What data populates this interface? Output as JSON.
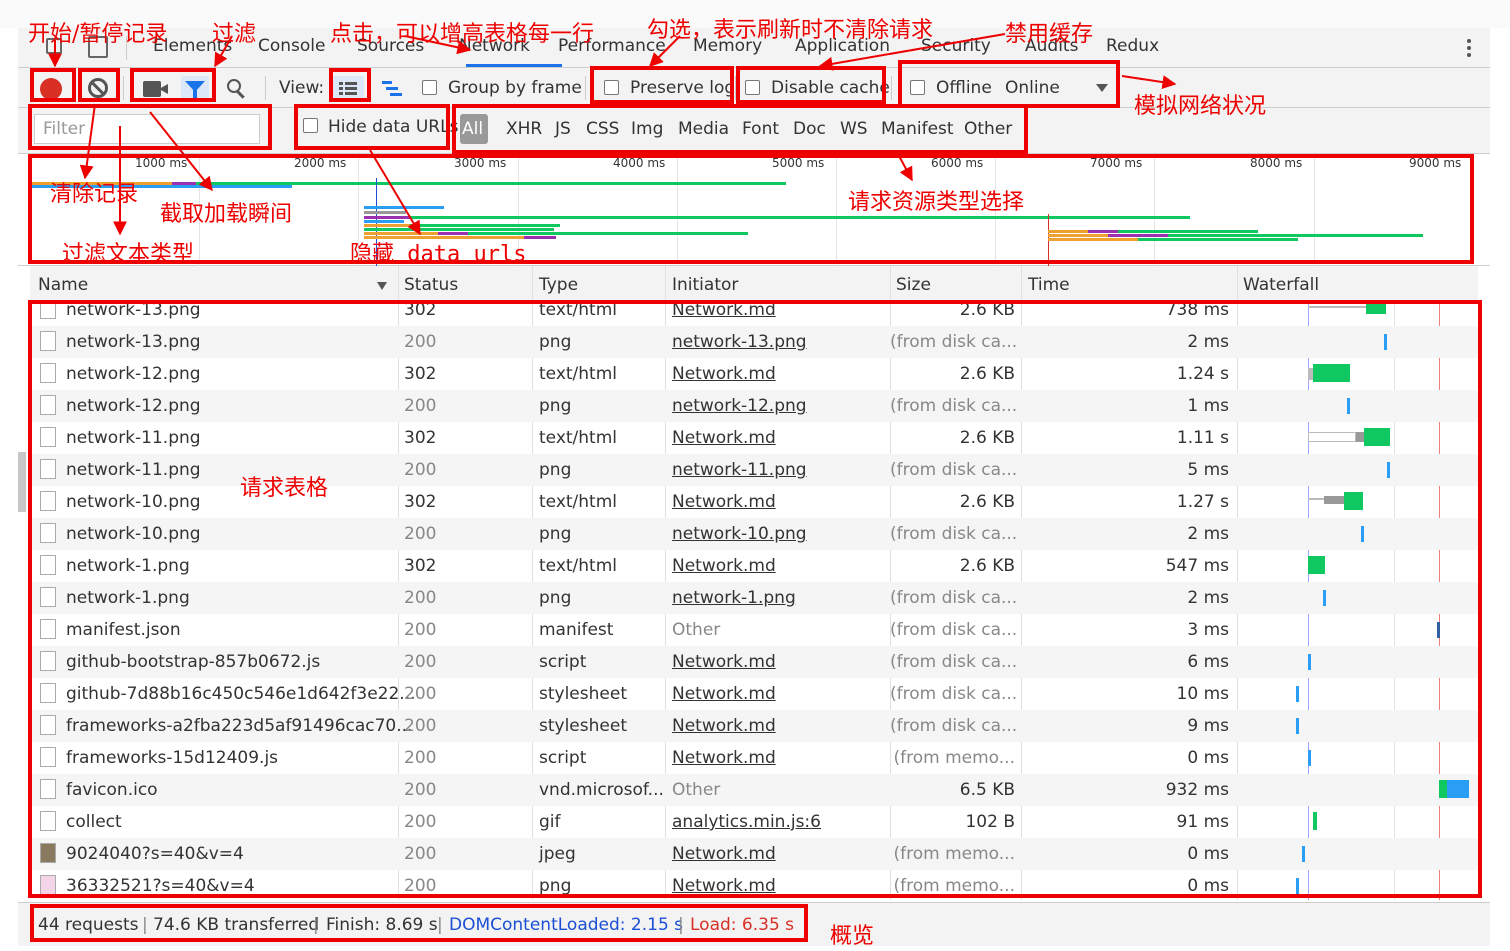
{
  "tabs": [
    "Elements",
    "Console",
    "Sources",
    "Network",
    "Performance",
    "Memory",
    "Application",
    "Security",
    "Audits",
    "Redux"
  ],
  "toolbar": {
    "view_label": "View:",
    "group_by_frame": "Group by frame",
    "preserve_log": "Preserve log",
    "disable_cache": "Disable cache",
    "offline": "Offline",
    "online": "Online",
    "filter_placeholder": "Filter",
    "hide_data_urls": "Hide data URLs",
    "types": [
      "All",
      "XHR",
      "JS",
      "CSS",
      "Img",
      "Media",
      "Font",
      "Doc",
      "WS",
      "Manifest",
      "Other"
    ]
  },
  "overview": {
    "ticks": [
      "1000 ms",
      "2000 ms",
      "3000 ms",
      "4000 ms",
      "5000 ms",
      "6000 ms",
      "7000 ms",
      "8000 ms",
      "9000 ms"
    ]
  },
  "columns": [
    "Name",
    "Status",
    "Type",
    "Initiator",
    "Size",
    "Time",
    "Waterfall"
  ],
  "rows": [
    {
      "name": "network-13.png",
      "status": "302",
      "type": "text/html",
      "initiator": "Network.md",
      "size": "2.6 KB",
      "time": "738 ms"
    },
    {
      "name": "network-13.png",
      "status": "200",
      "type": "png",
      "initiator": "network-13.png",
      "size": "(from disk ca...",
      "time": "2 ms"
    },
    {
      "name": "network-12.png",
      "status": "302",
      "type": "text/html",
      "initiator": "Network.md",
      "size": "2.6 KB",
      "time": "1.24 s"
    },
    {
      "name": "network-12.png",
      "status": "200",
      "type": "png",
      "initiator": "network-12.png",
      "size": "(from disk ca...",
      "time": "1 ms"
    },
    {
      "name": "network-11.png",
      "status": "302",
      "type": "text/html",
      "initiator": "Network.md",
      "size": "2.6 KB",
      "time": "1.11 s"
    },
    {
      "name": "network-11.png",
      "status": "200",
      "type": "png",
      "initiator": "network-11.png",
      "size": "(from disk ca...",
      "time": "5 ms"
    },
    {
      "name": "network-10.png",
      "status": "302",
      "type": "text/html",
      "initiator": "Network.md",
      "size": "2.6 KB",
      "time": "1.27 s"
    },
    {
      "name": "network-10.png",
      "status": "200",
      "type": "png",
      "initiator": "network-10.png",
      "size": "(from disk ca...",
      "time": "2 ms"
    },
    {
      "name": "network-1.png",
      "status": "302",
      "type": "text/html",
      "initiator": "Network.md",
      "size": "2.6 KB",
      "time": "547 ms"
    },
    {
      "name": "network-1.png",
      "status": "200",
      "type": "png",
      "initiator": "network-1.png",
      "size": "(from disk ca...",
      "time": "2 ms"
    },
    {
      "name": "manifest.json",
      "status": "200",
      "type": "manifest",
      "initiator": "Other",
      "size": "(from disk ca...",
      "time": "3 ms"
    },
    {
      "name": "github-bootstrap-857b0672.js",
      "status": "200",
      "type": "script",
      "initiator": "Network.md",
      "size": "(from disk ca...",
      "time": "6 ms"
    },
    {
      "name": "github-7d88b16c450c546e1d642f3e22...",
      "status": "200",
      "type": "stylesheet",
      "initiator": "Network.md",
      "size": "(from disk ca...",
      "time": "10 ms"
    },
    {
      "name": "frameworks-a2fba223d5af91496cac70...",
      "status": "200",
      "type": "stylesheet",
      "initiator": "Network.md",
      "size": "(from disk ca...",
      "time": "9 ms"
    },
    {
      "name": "frameworks-15d12409.js",
      "status": "200",
      "type": "script",
      "initiator": "Network.md",
      "size": "(from memo...",
      "time": "0 ms"
    },
    {
      "name": "favicon.ico",
      "status": "200",
      "type": "vnd.microsof...",
      "initiator": "Other",
      "size": "6.5 KB",
      "time": "932 ms"
    },
    {
      "name": "collect",
      "status": "200",
      "type": "gif",
      "initiator": "analytics.min.js:6",
      "size": "102 B",
      "time": "91 ms"
    },
    {
      "name": "9024040?s=40&v=4",
      "status": "200",
      "type": "jpeg",
      "initiator": "Network.md",
      "size": "(from memo...",
      "time": "0 ms"
    },
    {
      "name": "36332521?s=40&v=4",
      "status": "200",
      "type": "png",
      "initiator": "Network.md",
      "size": "(from memo...",
      "time": "0 ms"
    }
  ],
  "status": {
    "requests": "44 requests",
    "transferred": "74.6 KB transferred",
    "finish": "Finish: 8.69 s",
    "dcl": "DOMContentLoaded: 2.15 s",
    "load": "Load: 6.35 s",
    "sep": "|"
  },
  "annotations": {
    "start_stop": "开始/暂停记录",
    "filter": "过滤",
    "click_row": "点击，可以增高表格每一行",
    "preserve": "勾选，表示刷新时不清除请求",
    "disable_cache": "禁用缓存",
    "simulate_network": "模拟网络状况",
    "clear_log": "清除记录",
    "screenshot": "截取加载瞬间",
    "filter_text": "过滤文本类型",
    "hide_data_urls": "隐藏 data urls",
    "resource_type": "请求资源类型选择",
    "request_table": "请求表格",
    "overview": "概览"
  },
  "colors": {
    "annotation": "#ee0000",
    "record": "#d93025",
    "active_blue": "#1a73e8",
    "dcl_blue": "#1a4fd6",
    "load_red": "#d93025",
    "green_bar": "#10c860"
  }
}
